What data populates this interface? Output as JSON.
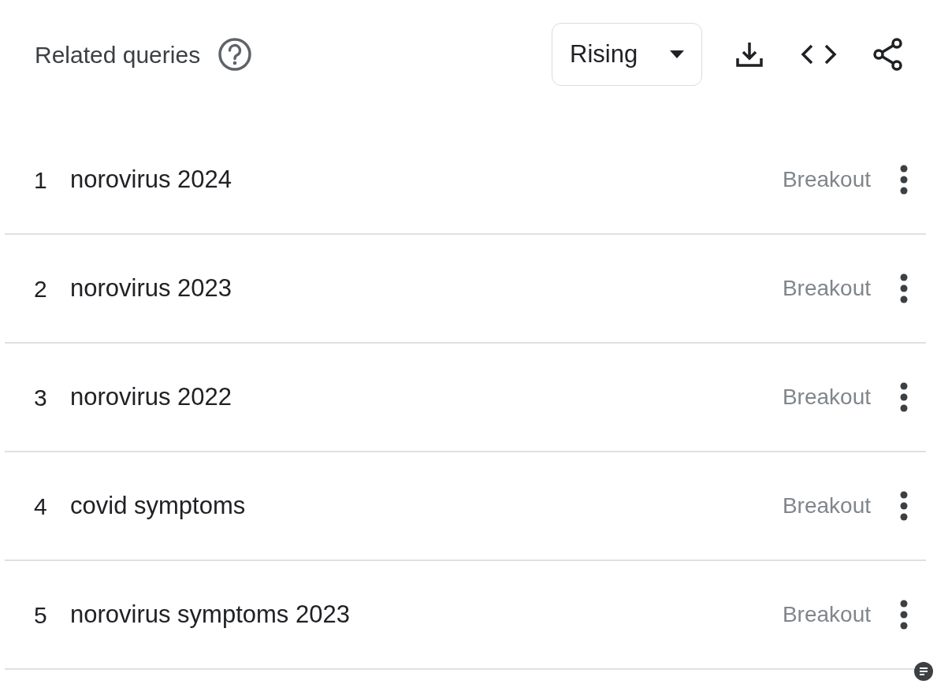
{
  "header": {
    "title": "Related queries",
    "dropdown": {
      "value": "Rising"
    }
  },
  "rows": [
    {
      "rank": "1",
      "query": "norovirus 2024",
      "value": "Breakout"
    },
    {
      "rank": "2",
      "query": "norovirus 2023",
      "value": "Breakout"
    },
    {
      "rank": "3",
      "query": "norovirus 2022",
      "value": "Breakout"
    },
    {
      "rank": "4",
      "query": "covid symptoms",
      "value": "Breakout"
    },
    {
      "rank": "5",
      "query": "norovirus symptoms 2023",
      "value": "Breakout"
    }
  ]
}
